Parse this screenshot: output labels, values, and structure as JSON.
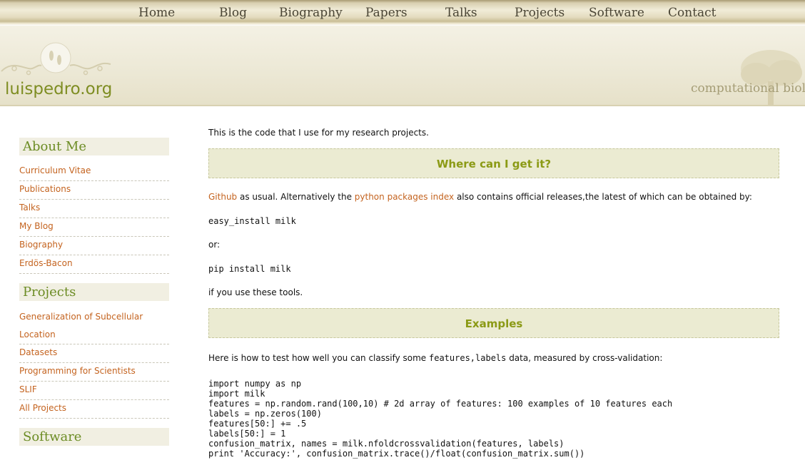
{
  "nav": {
    "items": [
      "Home",
      "Blog",
      "Biography",
      "Papers",
      "Talks",
      "Projects",
      "Software",
      "Contact"
    ]
  },
  "header": {
    "site_title": "luispedro.org",
    "tagline": "computational biolo"
  },
  "sidebar": {
    "sections": [
      {
        "heading": "About Me",
        "items": [
          "Curriculum Vitae",
          "Publications",
          "Talks",
          "My Blog",
          "Biography",
          "Erdös-Bacon"
        ]
      },
      {
        "heading": "Projects",
        "items": [
          "Generalization of Subcellular Location",
          "Datasets",
          "Programming for Scientists",
          "SLIF",
          "All Projects"
        ]
      },
      {
        "heading": "Software",
        "items": []
      }
    ]
  },
  "main": {
    "intro": "This is the code that I use for my research projects.",
    "where_heading": "Where can I get it?",
    "where_link_github": "Github",
    "where_text_1": " as usual. Alternatively the ",
    "where_link_pypi": "python packages index",
    "where_text_2": " also contains official releases,the latest of which can be obtained by:",
    "cmd_easy_install": "easy_install milk",
    "or_text": "or:",
    "cmd_pip": "pip install milk",
    "tools_text": "if you use these tools.",
    "examples_heading": "Examples",
    "examples_text_1": "Here is how to test how well you can classify some ",
    "examples_code": "features,labels",
    "examples_text_2": " data, measured by cross-validation:",
    "code_lines": [
      "import numpy as np",
      "import milk",
      "features = np.random.rand(100,10) # 2d array of features: 100 examples of 10 features each",
      "labels = np.zeros(100)",
      "features[50:] += .5",
      "labels[50:] = 1",
      "confusion_matrix, names = milk.nfoldcrossvalidation(features, labels)",
      "print 'Accuracy:', confusion_matrix.trace()/float(confusion_matrix.sum())"
    ]
  },
  "colors": {
    "link": "#c4631f",
    "site_title": "#7e8d22",
    "heading_green": "#6c8c24",
    "section_box_bg": "#ebebd2",
    "section_box_text": "#8b9a15"
  }
}
